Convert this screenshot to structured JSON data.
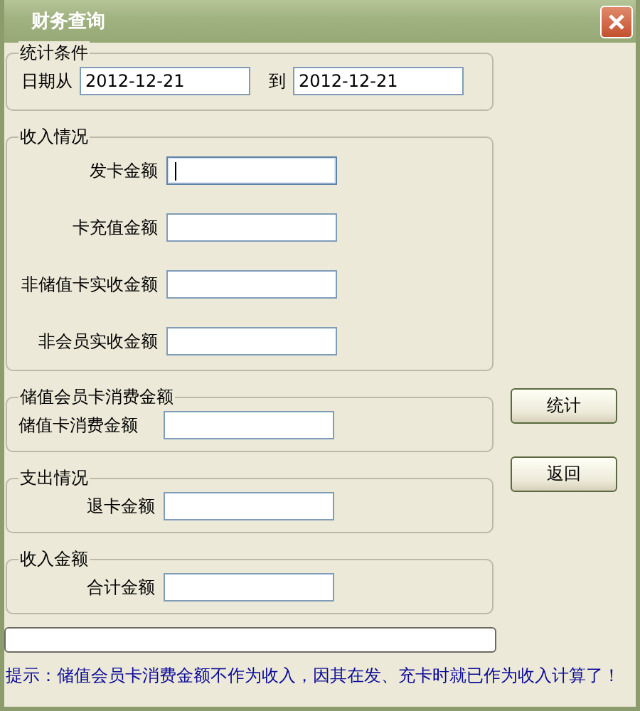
{
  "window": {
    "title": "财务查询"
  },
  "date_range": {
    "legend": "统计条件",
    "from_label": "日期从",
    "from_value": "2012-12-21",
    "to_label": "到",
    "to_value": "2012-12-21"
  },
  "groups": [
    {
      "legend": "收入情况",
      "kind": "tall",
      "fields": [
        {
          "label": "发卡金额",
          "focused": true
        },
        {
          "label": "卡充值金额",
          "focused": false
        },
        {
          "label": "非储值卡实收金额",
          "focused": false
        },
        {
          "label": "非会员实收金额",
          "focused": false
        }
      ]
    },
    {
      "legend": "储值会员卡消费金额",
      "kind": "short",
      "fields": [
        {
          "label": "储值卡消费金额",
          "focused": false
        }
      ]
    },
    {
      "legend": "支出情况",
      "kind": "short",
      "fields": [
        {
          "label": "退卡金额",
          "focused": false
        }
      ]
    },
    {
      "legend": "收入金额",
      "kind": "short",
      "fields": [
        {
          "label": "合计金额",
          "focused": false
        }
      ]
    }
  ],
  "buttons": [
    "统计",
    "返回"
  ],
  "progress": {
    "level": 0
  },
  "hint": "提示：储值会员卡消费金额不作为收入，因其在发、充卡时就已作为收入计算了！"
}
